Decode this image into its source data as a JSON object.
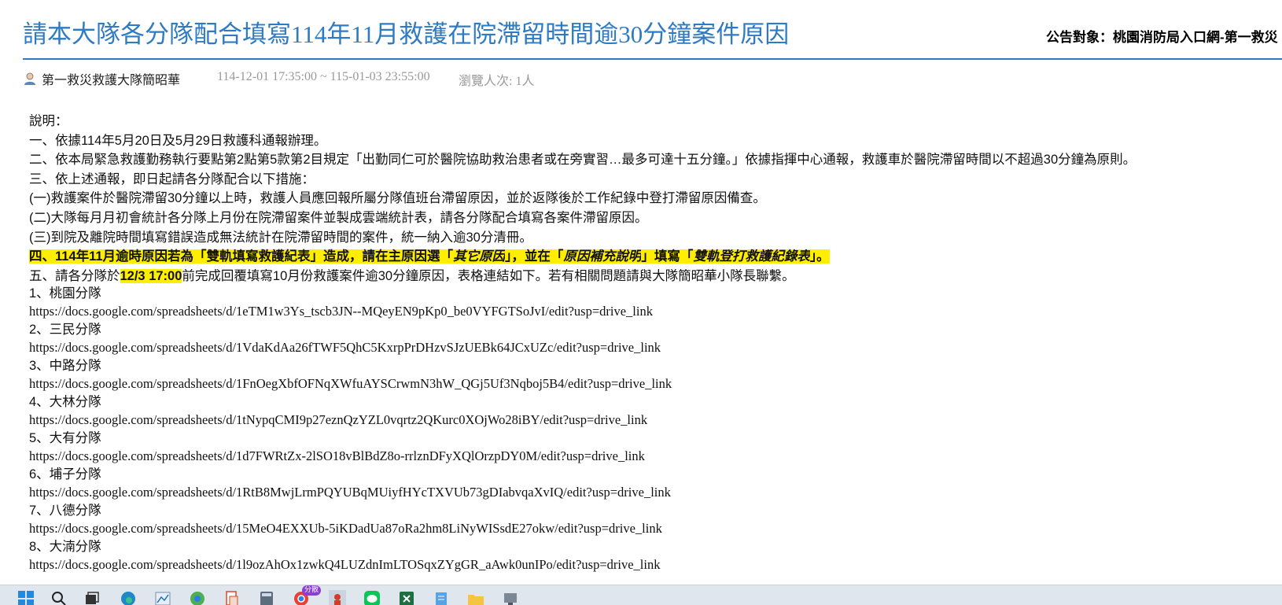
{
  "header": {
    "title": "請本大隊各分隊配合填寫114年11月救護在院滯留時間逾30分鐘案件原因",
    "audience": "公告對象：桃園消防局入口網-第一救災"
  },
  "meta": {
    "author": "第一救災救護大隊簡昭華",
    "date_range": "114-12-01 17:35:00 ~ 115-01-03 23:55:00",
    "views": "瀏覽人次: 1人"
  },
  "body": {
    "intro": "說明：",
    "p1": "一、依據114年5月20日及5月29日救護科通報辦理。",
    "p2": "二、依本局緊急救護勤務執行要點第2點第5款第2目規定「出勤同仁可於醫院協助救治患者或在旁實習…最多可達十五分鐘。」依據指揮中心通報，救護車於醫院滯留時間以不超過30分鐘為原則。",
    "p3": "三、依上述通報，即日起請各分隊配合以下措施：",
    "p3a": "(一)救護案件於醫院滯留30分鐘以上時，救護人員應回報所屬分隊值班台滯留原因，並於返隊後於工作紀錄中登打滯留原因備查。",
    "p3b": "(二)大隊每月月初會統計各分隊上月份在院滯留案件並製成雲端統計表，請各分隊配合填寫各案件滯留原因。",
    "p3c": "(三)到院及離院時間填寫錯誤造成無法統計在院滯留時間的案件，統一納入逾30分清冊。",
    "p4_a": "四、114年11月逾時原因若為「雙軌填寫救護紀表」造成，請在主原因選「",
    "p4_b": "其它原因",
    "p4_c": "」，並在「",
    "p4_d": "原因補充說明",
    "p4_e": "」填寫「",
    "p4_f": "雙軌登打救護紀錄表",
    "p4_g": "」。",
    "p5_a": "五、請各分隊於",
    "p5_b": "12/3 17:00",
    "p5_c": "前完成回覆填寫10月份救護案件逾30分鐘原因，表格連結如下。若有相關問題請與大隊簡昭華小隊長聯繫。",
    "branches": [
      {
        "name": "1、桃園分隊",
        "url": "https://docs.google.com/spreadsheets/d/1eTM1w3Ys_tscb3JN--MQeyEN9pKp0_be0VYFGTSoJvI/edit?usp=drive_link"
      },
      {
        "name": "2、三民分隊",
        "url": "https://docs.google.com/spreadsheets/d/1VdaKdAa26fTWF5QhC5KxrpPrDHzvSJzUEBk64JCxUZc/edit?usp=drive_link"
      },
      {
        "name": "3、中路分隊",
        "url": "https://docs.google.com/spreadsheets/d/1FnOegXbfOFNqXWfuAYSCrwmN3hW_QGj5Uf3Nqboj5B4/edit?usp=drive_link"
      },
      {
        "name": "4、大林分隊",
        "url": "https://docs.google.com/spreadsheets/d/1tNypqCMI9p27eznQzYZL0vqrtz2QKurc0XOjWo28iBY/edit?usp=drive_link"
      },
      {
        "name": "5、大有分隊",
        "url": "https://docs.google.com/spreadsheets/d/1d7FWRtZx-2lSO18vBlBdZ8o-rrlznDFyXQlOrzpDY0M/edit?usp=drive_link"
      },
      {
        "name": "6、埔子分隊",
        "url": "https://docs.google.com/spreadsheets/d/1RtB8MwjLrmPQYUBqMUiyfHYcTXVUb73gDIabvqaXvIQ/edit?usp=drive_link"
      },
      {
        "name": "7、八德分隊",
        "url": "https://docs.google.com/spreadsheets/d/15MeO4EXXUb-5iKDadUa87oRa2hm8LiNyWISsdE27okw/edit?usp=drive_link"
      },
      {
        "name": "8、大湳分隊",
        "url": "https://docs.google.com/spreadsheets/d/1l9ozAhOx1zwkQ4LUZdnImLTOSqxZYgGR_aAwk0unIPo/edit?usp=drive_link"
      }
    ]
  },
  "taskbar": {
    "icons": [
      "windows-start-icon",
      "search-icon",
      "task-view-icon",
      "edge-browser-icon",
      "chart-app-icon",
      "chrome-profile-icon",
      "file-icon",
      "calculator-icon",
      "chrome-icon",
      "app-icon",
      "line-icon",
      "excel-icon",
      "notepad-icon",
      "folder-icon",
      "settings-icon"
    ],
    "chrome_badge": "分散"
  },
  "colors": {
    "title": "#2e7bc4",
    "highlight": "#ffee00",
    "muted": "#999999"
  }
}
